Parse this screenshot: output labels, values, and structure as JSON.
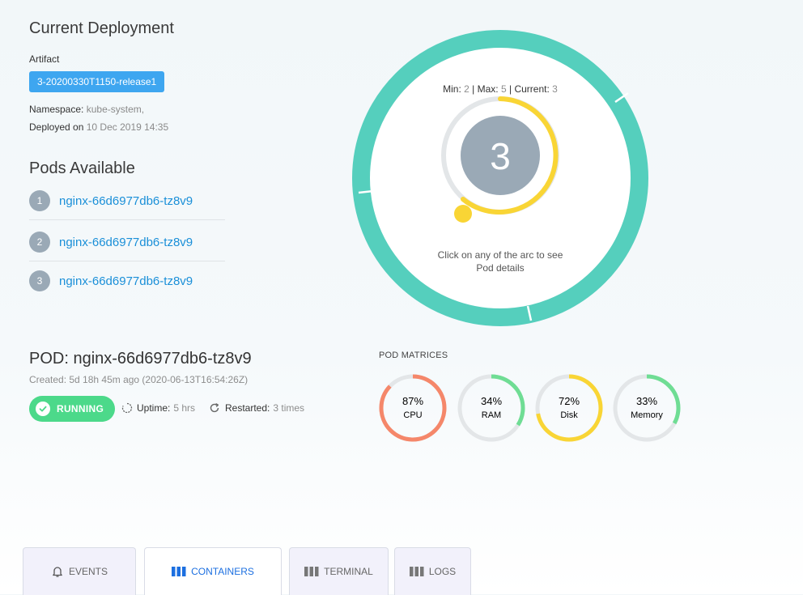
{
  "deployment": {
    "title": "Current Deployment",
    "artifact_label": "Artifact",
    "artifact_value": "3-20200330T1150-release1",
    "namespace_label": "Namespace:",
    "namespace_value": "kube-system,",
    "deployed_label": "Deployed on",
    "deployed_value": "10 Dec 2019 14:35"
  },
  "pods": {
    "title": "Pods Available",
    "items": [
      {
        "num": "1",
        "name": "nginx-66d6977db6-tz8v9"
      },
      {
        "num": "2",
        "name": "nginx-66d6977db6-tz8v9"
      },
      {
        "num": "3",
        "name": "nginx-66d6977db6-tz8v9"
      }
    ]
  },
  "replicas": {
    "min_label": "Min:",
    "min": "2",
    "max_label": "| Max:",
    "max": "5",
    "current_label": "| Current:",
    "current": "3",
    "center_value": "3",
    "hint_line1": "Click on any of the arc to see",
    "hint_line2": "Pod details",
    "colors": {
      "ring": "#55cfbd",
      "arc": "#f9d535",
      "center": "#9aa9b6",
      "track": "#e3e6e8"
    }
  },
  "pod": {
    "title": "POD: nginx-66d6977db6-tz8v9",
    "created": "Created: 5d 18h 45m ago (2020-06-13T16:54:26Z)",
    "status": "RUNNING",
    "uptime_label": "Uptime:",
    "uptime_value": "5 hrs",
    "restarted_label": "Restarted:",
    "restarted_value": "3 times"
  },
  "matrices": {
    "title": "POD MATRICES",
    "gauges": [
      {
        "value": "87%",
        "label": "CPU",
        "fraction": 0.87,
        "color": "#f5876a"
      },
      {
        "value": "34%",
        "label": "RAM",
        "fraction": 0.34,
        "color": "#6fdd94"
      },
      {
        "value": "72%",
        "label": "Disk",
        "fraction": 0.72,
        "color": "#f9d535"
      },
      {
        "value": "33%",
        "label": "Memory",
        "fraction": 0.33,
        "color": "#6fdd94"
      }
    ]
  },
  "tabs": [
    {
      "label": "EVENTS",
      "icon": "bell-icon",
      "active": false
    },
    {
      "label": "CONTAINERS",
      "icon": "columns-icon",
      "active": true
    },
    {
      "label": "TERMINAL",
      "icon": "columns-icon",
      "active": false
    },
    {
      "label": "LOGS",
      "icon": "columns-icon",
      "active": false
    }
  ]
}
